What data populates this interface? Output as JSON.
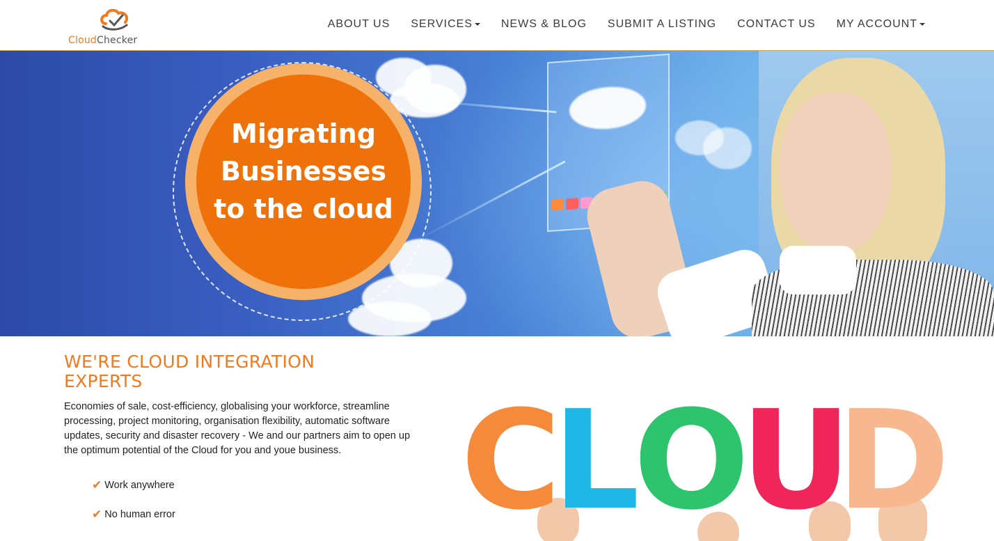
{
  "header": {
    "logo": {
      "part1": "Cloud",
      "part2": "Checker"
    },
    "nav": [
      {
        "label": "ABOUT US",
        "dropdown": false
      },
      {
        "label": "SERVICES",
        "dropdown": true
      },
      {
        "label": "NEWS & BLOG",
        "dropdown": false
      },
      {
        "label": "SUBMIT A LISTING",
        "dropdown": false
      },
      {
        "label": "CONTACT US",
        "dropdown": false
      },
      {
        "label": "MY ACCOUNT",
        "dropdown": true
      }
    ]
  },
  "hero": {
    "badge_line1": "Migrating",
    "badge_line2": "Businesses",
    "badge_line3": "to the cloud"
  },
  "intro": {
    "heading_line1": "WE'RE CLOUD INTEGRATION",
    "heading_line2": "EXPERTS",
    "paragraph": "Economies of sale, cost-efficiency, globalising your workforce, streamline processing, project monitoring, organisation flexibility, automatic software updates, security and disaster recovery - We and our partners aim to open up the optimum potential of the Cloud for you and youe business.",
    "features": [
      "Work anywhere",
      "No human error"
    ]
  },
  "cloud_image": {
    "letters": [
      "C",
      "L",
      "O",
      "U",
      "D"
    ]
  },
  "colors": {
    "accent": "#ef7a1f",
    "nav_text": "#3a3a3a",
    "hero_blue": "#2d4aa6",
    "badge_orange": "#ee7209",
    "badge_ring": "#f7b26a"
  }
}
